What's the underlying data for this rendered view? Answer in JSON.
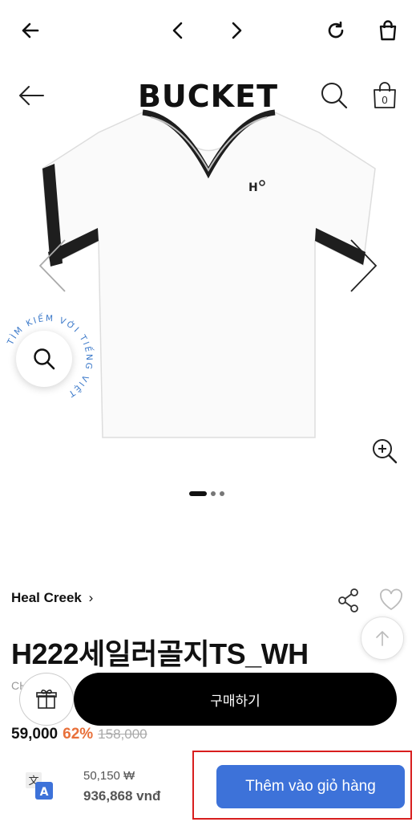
{
  "header": {
    "logo": "BUCKET",
    "cart_count": "0"
  },
  "search_fab": {
    "circular_label": "TÌM KIẾM VỚI TIẾNG VIỆT"
  },
  "carousel": {
    "total": 3,
    "active": 1
  },
  "product": {
    "brand": "Heal Creek",
    "brand_chevron": "›",
    "title": "H222세일러골지TS_WH",
    "code_partial": "CH",
    "price": "59,000",
    "discount": "62%",
    "original_price": "158,000"
  },
  "actions": {
    "buy_label": "구매하기"
  },
  "bottom": {
    "krw_price": "50,150 ₩",
    "vnd_price": "936,868 vnđ",
    "add_to_cart_label": "Thêm vào giỏ hàng"
  }
}
